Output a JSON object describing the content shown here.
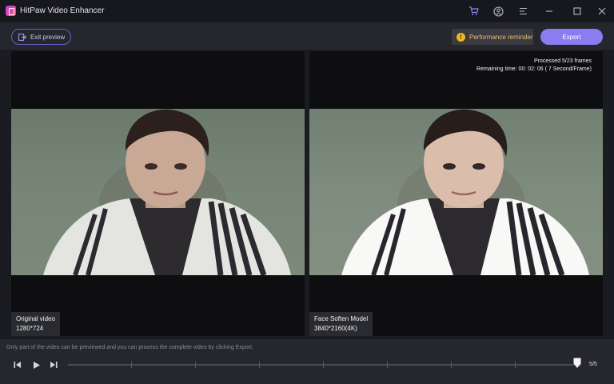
{
  "window": {
    "title": "HitPaw Video Enhancer"
  },
  "titlebar_icons": [
    "cart-icon",
    "account-icon",
    "menu-icon",
    "minimize-icon",
    "maximize-icon",
    "close-icon"
  ],
  "toolbar": {
    "exit_label": "Exit preview",
    "performance_label": "Performance reminder",
    "export_label": "Export"
  },
  "left_panel": {
    "name": "Original video",
    "resolution": "1280*724"
  },
  "right_panel": {
    "name": "Face Soften Model",
    "resolution": "3840*2160(4K)",
    "processed": "Processed 5/23 frames",
    "remaining": "Remaining time: 00: 02: 06 ( 7 Second/Frame)"
  },
  "footer": {
    "hint": "Only part of the video can be previewed and you can process the complete video by clicking Export.",
    "page": "5/5",
    "progress": 1.0
  },
  "colors": {
    "accent": "#8b7cf2",
    "warning": "#f2b51f",
    "background": "#1b1c22"
  }
}
